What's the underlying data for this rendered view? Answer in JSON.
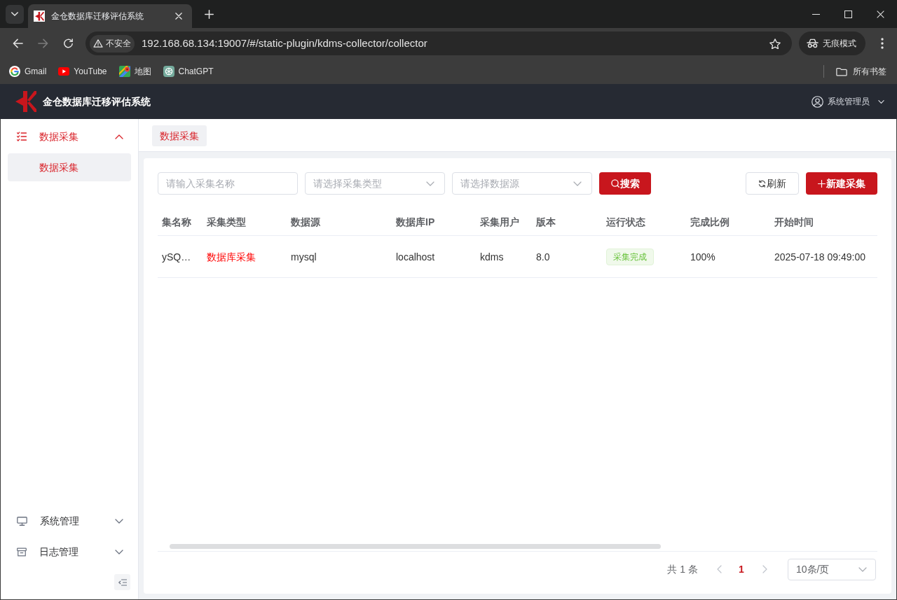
{
  "browser": {
    "tabs": [
      {
        "title": "金仓数据库迁移评估系统",
        "selected": true
      }
    ],
    "nav_buttons": [
      {
        "kind": "back",
        "disabled": false
      },
      {
        "kind": "forward",
        "disabled": true
      },
      {
        "kind": "reload",
        "disabled": false
      }
    ],
    "address_bar": {
      "security_label": "不安全",
      "url": "192.168.68.134:19007/#/static-plugin/kdms-collector/collector"
    },
    "profile_label": "无痕模式",
    "bookmarks": [
      {
        "label": "Gmail"
      },
      {
        "label": "YouTube"
      },
      {
        "label": "地图"
      },
      {
        "label": "ChatGPT"
      }
    ],
    "all_bookmarks": "所有书签"
  },
  "app": {
    "title": "金仓数据库迁移评估系统",
    "user": "系统管理员"
  },
  "sidebar": {
    "items": [
      {
        "label": "数据采集",
        "selected": true,
        "expanded": true,
        "children": [
          {
            "label": "数据采集",
            "selected": true
          }
        ]
      }
    ],
    "footer_items": [
      {
        "label": "系统管理",
        "selected": false,
        "expanded": false
      },
      {
        "label": "日志管理",
        "selected": false,
        "expanded": false
      }
    ]
  },
  "page_tabs": [
    {
      "label": "数据采集",
      "selected": true
    }
  ],
  "filters": [
    {
      "kind": "input",
      "placeholder": "请输入采集名称"
    },
    {
      "kind": "select",
      "placeholder": "请选择采集类型"
    },
    {
      "kind": "select",
      "placeholder": "请选择数据源"
    }
  ],
  "search_button": "搜索",
  "refresh_button": "刷新",
  "create_button": "新建采集",
  "table": {
    "columns": [
      {
        "label": "集名称",
        "kind": "text"
      },
      {
        "label": "采集类型",
        "kind": "accent"
      },
      {
        "label": "数据源",
        "kind": "text"
      },
      {
        "label": "数据库IP",
        "kind": "text"
      },
      {
        "label": "采集用户",
        "kind": "text"
      },
      {
        "label": "版本",
        "kind": "text"
      },
      {
        "label": "运行状态",
        "kind": "tag"
      },
      {
        "label": "完成比例",
        "kind": "text"
      },
      {
        "label": "开始时间",
        "kind": "text"
      }
    ],
    "rows": [
      {
        "cells": [
          "ySQ…",
          "数据库采集",
          "mysql",
          "localhost",
          "kdms",
          "8.0",
          "采集完成",
          "100%",
          "2025-07-18 09:49:00"
        ]
      }
    ]
  },
  "pagination": {
    "total": "共 1 条",
    "prev_disabled": true,
    "next_disabled": true,
    "pages": [
      {
        "label": "1",
        "selected": true
      }
    ],
    "page_size": "10条/页"
  }
}
